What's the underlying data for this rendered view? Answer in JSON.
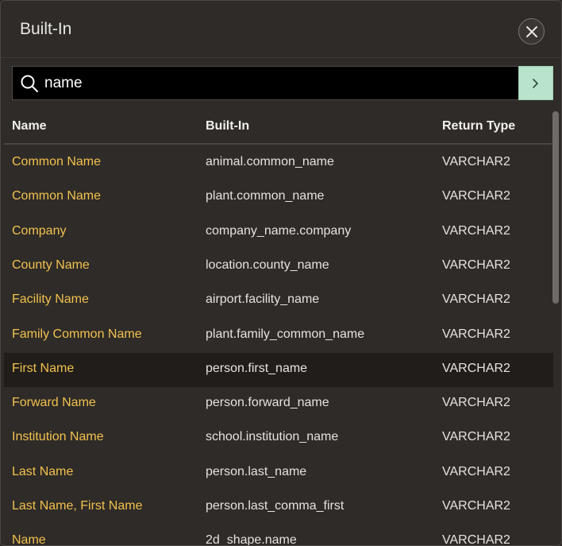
{
  "dialog": {
    "title": "Built-In",
    "close_icon": "close-icon"
  },
  "search": {
    "value": "name",
    "icon": "search-icon",
    "go_icon": "chevron-right-icon"
  },
  "table": {
    "columns": [
      "Name",
      "Built-In",
      "Return Type"
    ],
    "rows": [
      {
        "name": "Common Name",
        "builtin": "animal.common_name",
        "rtype": "VARCHAR2"
      },
      {
        "name": "Common Name",
        "builtin": "plant.common_name",
        "rtype": "VARCHAR2"
      },
      {
        "name": "Company",
        "builtin": "company_name.company",
        "rtype": "VARCHAR2"
      },
      {
        "name": "County Name",
        "builtin": "location.county_name",
        "rtype": "VARCHAR2"
      },
      {
        "name": "Facility Name",
        "builtin": "airport.facility_name",
        "rtype": "VARCHAR2"
      },
      {
        "name": "Family Common Name",
        "builtin": "plant.family_common_name",
        "rtype": "VARCHAR2"
      },
      {
        "name": "First Name",
        "builtin": "person.first_name",
        "rtype": "VARCHAR2"
      },
      {
        "name": "Forward Name",
        "builtin": "person.forward_name",
        "rtype": "VARCHAR2"
      },
      {
        "name": "Institution Name",
        "builtin": "school.institution_name",
        "rtype": "VARCHAR2"
      },
      {
        "name": "Last Name",
        "builtin": "person.last_name",
        "rtype": "VARCHAR2"
      },
      {
        "name": "Last Name, First Name",
        "builtin": "person.last_comma_first",
        "rtype": "VARCHAR2"
      },
      {
        "name": "Name",
        "builtin": "2d_shape.name",
        "rtype": "VARCHAR2"
      }
    ],
    "highlighted_row": 6
  },
  "colors": {
    "background": "#2e2b28",
    "link": "#f2c14e",
    "go_button": "#b9e3cb"
  }
}
